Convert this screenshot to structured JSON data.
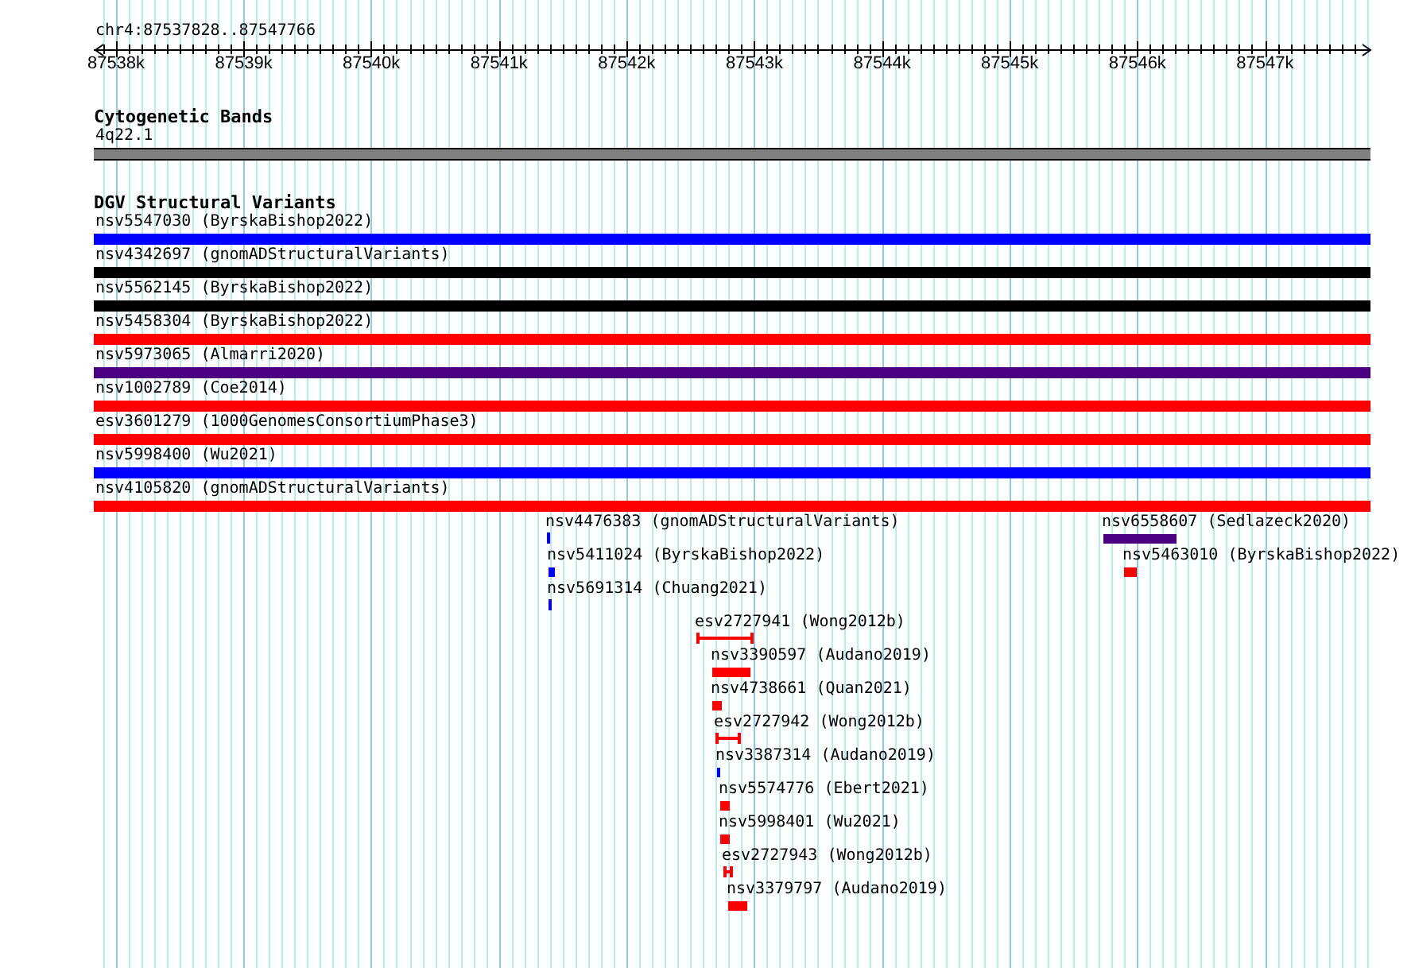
{
  "location": "chr4:87537828..87547766",
  "ruler": {
    "labels": [
      "87538k",
      "87539k",
      "87540k",
      "87541k",
      "87542k",
      "87543k",
      "87544k",
      "87545k",
      "87546k",
      "87547k"
    ]
  },
  "tracks": [
    {
      "title": "Cytogenetic Bands",
      "features": [
        {
          "label": "4q22.1",
          "kind": "band",
          "color": "#808080"
        }
      ]
    },
    {
      "title": "DGV Structural Variants",
      "features": [
        {
          "label": "nsv5547030 (ByrskaBishop2022)",
          "kind": "full",
          "color": "#0000ff"
        },
        {
          "label": "nsv4342697 (gnomADStructuralVariants)",
          "kind": "full",
          "color": "#000000"
        },
        {
          "label": "nsv5562145 (ByrskaBishop2022)",
          "kind": "full",
          "color": "#000000"
        },
        {
          "label": "nsv5458304 (ByrskaBishop2022)",
          "kind": "full",
          "color": "#ff0000"
        },
        {
          "label": "nsv5973065 (Almarri2020)",
          "kind": "full",
          "color": "#4b0082"
        },
        {
          "label": "nsv1002789 (Coe2014)",
          "kind": "full",
          "color": "#ff0000"
        },
        {
          "label": "esv3601279 (1000GenomesConsortiumPhase3)",
          "kind": "full",
          "color": "#ff0000"
        },
        {
          "label": "nsv5998400 (Wu2021)",
          "kind": "full",
          "color": "#0000ff"
        },
        {
          "label": "nsv4105820 (gnomADStructuralVariants)",
          "kind": "full",
          "color": "#ff0000"
        },
        {
          "label": "nsv4476383 (gnomADStructuralVariants)",
          "kind": "bar",
          "color": "#0000ff"
        },
        {
          "label": "nsv6558607 (Sedlazeck2020)",
          "kind": "bar",
          "color": "#4b0082"
        },
        {
          "label": "nsv5411024 (ByrskaBishop2022)",
          "kind": "bar",
          "color": "#0000ff"
        },
        {
          "label": "nsv5463010 (ByrskaBishop2022)",
          "kind": "bar",
          "color": "#ff0000"
        },
        {
          "label": "nsv5691314 (Chuang2021)",
          "kind": "bar",
          "color": "#0000ff"
        },
        {
          "label": "esv2727941 (Wong2012b)",
          "kind": "interval",
          "color": "#ff0000"
        },
        {
          "label": "nsv3390597 (Audano2019)",
          "kind": "bar",
          "color": "#ff0000"
        },
        {
          "label": "nsv4738661 (Quan2021)",
          "kind": "bar",
          "color": "#ff0000"
        },
        {
          "label": "esv2727942 (Wong2012b)",
          "kind": "interval",
          "color": "#ff0000"
        },
        {
          "label": "nsv3387314 (Audano2019)",
          "kind": "bar",
          "color": "#0000ff"
        },
        {
          "label": "nsv5574776 (Ebert2021)",
          "kind": "bar",
          "color": "#ff0000"
        },
        {
          "label": "nsv5998401 (Wu2021)",
          "kind": "bar",
          "color": "#ff0000"
        },
        {
          "label": "esv2727943 (Wong2012b)",
          "kind": "interval",
          "color": "#ff0000"
        },
        {
          "label": "nsv3379797 (Audano2019)",
          "kind": "bar",
          "color": "#ff0000"
        }
      ]
    }
  ]
}
